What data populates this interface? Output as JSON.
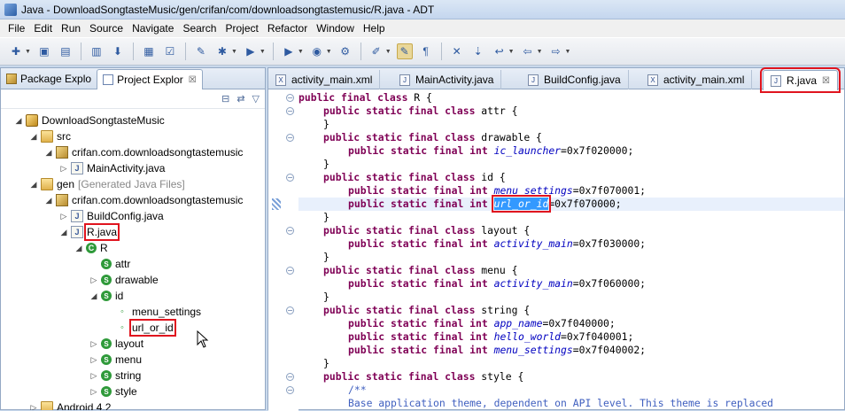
{
  "window": {
    "title": "Java - DownloadSongtasteMusic/gen/crifan/com/downloadsongtastemusic/R.java - ADT"
  },
  "menu": [
    "File",
    "Edit",
    "Run",
    "Source",
    "Navigate",
    "Search",
    "Project",
    "Refactor",
    "Window",
    "Help"
  ],
  "toolbar_icons": [
    "new-icon",
    "save-icon",
    "save-all-icon",
    "print-icon",
    "download-icon",
    "android-sdk-icon",
    "checkbox-icon",
    "new-file-icon",
    "debug-icon",
    "run-icon",
    "run-external-icon",
    "new-java-icon",
    "open-type-icon",
    "open-task-icon",
    "mark-occurrences-icon",
    "show-whitespace-icon",
    "pin-icon",
    "next-annotation-icon",
    "prev-edit-icon",
    "back-icon",
    "forward-icon"
  ],
  "left": {
    "tabs": [
      {
        "label": "Package Explo"
      },
      {
        "label": "Project Explor",
        "close": "☒"
      }
    ],
    "tree": [
      {
        "label": "DownloadSongtasteMusic",
        "icon": "project",
        "twisty": "◢",
        "indent": 0
      },
      {
        "label": "src",
        "icon": "folder",
        "twisty": "◢",
        "indent": 1
      },
      {
        "label": "crifan.com.downloadsongtastemusic",
        "icon": "pkg",
        "twisty": "◢",
        "indent": 2
      },
      {
        "label": "MainActivity.java",
        "icon": "java",
        "twisty": "▷",
        "indent": 3
      },
      {
        "label": "gen",
        "extra": "[Generated Java Files]",
        "icon": "folder",
        "twisty": "◢",
        "indent": 1
      },
      {
        "label": "crifan.com.downloadsongtastemusic",
        "icon": "pkg",
        "twisty": "◢",
        "indent": 2
      },
      {
        "label": "BuildConfig.java",
        "icon": "java",
        "twisty": "▷",
        "indent": 3
      },
      {
        "label": "R.java",
        "icon": "java",
        "twisty": "◢",
        "indent": 3,
        "boxed": true
      },
      {
        "label": "R",
        "icon": "class",
        "twisty": "◢",
        "indent": 4
      },
      {
        "label": "attr",
        "icon": "sclass",
        "twisty": "",
        "indent": 5
      },
      {
        "label": "drawable",
        "icon": "sclass",
        "twisty": "▷",
        "indent": 5
      },
      {
        "label": "id",
        "icon": "sclass",
        "twisty": "◢",
        "indent": 5
      },
      {
        "label": "menu_settings",
        "icon": "field",
        "twisty": "",
        "indent": 6
      },
      {
        "label": "url_or_id",
        "icon": "field",
        "twisty": "",
        "indent": 6,
        "boxed": true
      },
      {
        "label": "layout",
        "icon": "sclass",
        "twisty": "▷",
        "indent": 5
      },
      {
        "label": "menu",
        "icon": "sclass",
        "twisty": "▷",
        "indent": 5
      },
      {
        "label": "string",
        "icon": "sclass",
        "twisty": "▷",
        "indent": 5
      },
      {
        "label": "style",
        "icon": "sclass",
        "twisty": "▷",
        "indent": 5
      },
      {
        "label": "Android 4.2",
        "icon": "folder",
        "twisty": "▷",
        "indent": 1
      }
    ]
  },
  "editor": {
    "tabs": [
      {
        "label": "activity_main.xml",
        "icon": "xml"
      },
      {
        "label": "MainActivity.java",
        "icon": "java"
      },
      {
        "label": "BuildConfig.java",
        "icon": "java"
      },
      {
        "label": "activity_main.xml",
        "icon": "xml"
      },
      {
        "label": "R.java",
        "icon": "java",
        "active": true,
        "close": "☒"
      }
    ],
    "code": [
      {
        "indent": 0,
        "parts": [
          [
            "kw",
            "public final class"
          ],
          [
            "t",
            " R {"
          ]
        ],
        "fold": "⊖"
      },
      {
        "indent": 1,
        "parts": [
          [
            "kw",
            "public static final class"
          ],
          [
            "t",
            " attr {"
          ]
        ],
        "fold": "⊖"
      },
      {
        "indent": 1,
        "parts": [
          [
            "t",
            "}"
          ]
        ]
      },
      {
        "indent": 1,
        "parts": [
          [
            "kw",
            "public static final class"
          ],
          [
            "t",
            " drawable {"
          ]
        ],
        "fold": "⊖"
      },
      {
        "indent": 2,
        "parts": [
          [
            "kw",
            "public static final int"
          ],
          [
            "t",
            " "
          ],
          [
            "fld",
            "ic_launcher"
          ],
          [
            "t",
            "=0x7f020000;"
          ]
        ]
      },
      {
        "indent": 1,
        "parts": [
          [
            "t",
            "}"
          ]
        ]
      },
      {
        "indent": 1,
        "parts": [
          [
            "kw",
            "public static final class"
          ],
          [
            "t",
            " id {"
          ]
        ],
        "fold": "⊖"
      },
      {
        "indent": 2,
        "parts": [
          [
            "kw",
            "public static final int"
          ],
          [
            "t",
            " "
          ],
          [
            "fld",
            "menu_settings"
          ],
          [
            "t",
            "=0x7f070001;"
          ]
        ]
      },
      {
        "indent": 2,
        "parts": [
          [
            "kw",
            "public static final int"
          ],
          [
            "t",
            " "
          ],
          [
            "sel",
            "url_or_id"
          ],
          [
            "t",
            "=0x7f070000;"
          ]
        ],
        "highlight": true
      },
      {
        "indent": 1,
        "parts": [
          [
            "t",
            "}"
          ]
        ]
      },
      {
        "indent": 1,
        "parts": [
          [
            "kw",
            "public static final class"
          ],
          [
            "t",
            " layout {"
          ]
        ],
        "fold": "⊖"
      },
      {
        "indent": 2,
        "parts": [
          [
            "kw",
            "public static final int"
          ],
          [
            "t",
            " "
          ],
          [
            "fld",
            "activity_main"
          ],
          [
            "t",
            "=0x7f030000;"
          ]
        ]
      },
      {
        "indent": 1,
        "parts": [
          [
            "t",
            "}"
          ]
        ]
      },
      {
        "indent": 1,
        "parts": [
          [
            "kw",
            "public static final class"
          ],
          [
            "t",
            " menu {"
          ]
        ],
        "fold": "⊖"
      },
      {
        "indent": 2,
        "parts": [
          [
            "kw",
            "public static final int"
          ],
          [
            "t",
            " "
          ],
          [
            "fld",
            "activity_main"
          ],
          [
            "t",
            "=0x7f060000;"
          ]
        ]
      },
      {
        "indent": 1,
        "parts": [
          [
            "t",
            "}"
          ]
        ]
      },
      {
        "indent": 1,
        "parts": [
          [
            "kw",
            "public static final class"
          ],
          [
            "t",
            " string {"
          ]
        ],
        "fold": "⊖"
      },
      {
        "indent": 2,
        "parts": [
          [
            "kw",
            "public static final int"
          ],
          [
            "t",
            " "
          ],
          [
            "fld",
            "app_name"
          ],
          [
            "t",
            "=0x7f040000;"
          ]
        ]
      },
      {
        "indent": 2,
        "parts": [
          [
            "kw",
            "public static final int"
          ],
          [
            "t",
            " "
          ],
          [
            "fld",
            "hello_world"
          ],
          [
            "t",
            "=0x7f040001;"
          ]
        ]
      },
      {
        "indent": 2,
        "parts": [
          [
            "kw",
            "public static final int"
          ],
          [
            "t",
            " "
          ],
          [
            "fld",
            "menu_settings"
          ],
          [
            "t",
            "=0x7f040002;"
          ]
        ]
      },
      {
        "indent": 1,
        "parts": [
          [
            "t",
            "}"
          ]
        ]
      },
      {
        "indent": 1,
        "parts": [
          [
            "kw",
            "public static final class"
          ],
          [
            "t",
            " style {"
          ]
        ],
        "fold": "⊖"
      },
      {
        "indent": 2,
        "parts": [
          [
            "cm",
            "/**"
          ]
        ],
        "fold": "⊖"
      },
      {
        "indent": 2,
        "parts": [
          [
            "cm",
            "Base application theme, dependent on API level. This theme is replaced"
          ]
        ]
      }
    ]
  },
  "colors": {
    "accent_red": "#e0141e",
    "keyword": "#7f0055",
    "field": "#0000c0",
    "selection": "#3399ff"
  }
}
